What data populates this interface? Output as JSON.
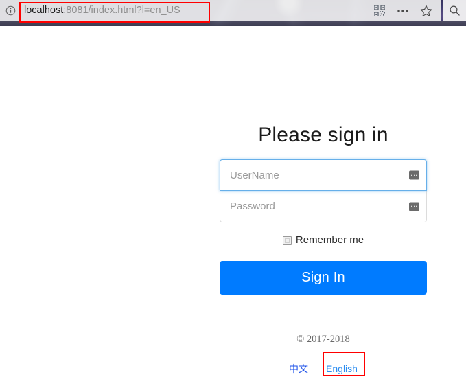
{
  "browser": {
    "site_info_icon": "info-circle-icon",
    "url": {
      "host": "localhost",
      "rest": ":8081/index.html?l=en_US",
      "full": "localhost:8081/index.html?l=en_US"
    },
    "actions": [
      {
        "name": "qr-code-icon",
        "label": "QR code"
      },
      {
        "name": "more-options-icon",
        "label": "More"
      },
      {
        "name": "favorite-star-icon",
        "label": "Add to favorites"
      }
    ],
    "search_button": {
      "name": "search-icon",
      "label": "Search"
    }
  },
  "annotations": {
    "url_highlight": "red-rectangle-around-address-bar",
    "english_highlight": "red-rectangle-around-english-link"
  },
  "page": {
    "title": "Please sign in",
    "username": {
      "placeholder": "UserName",
      "value": "",
      "addon_icon": "broken-image-icon"
    },
    "password": {
      "placeholder": "Password",
      "value": "",
      "addon_icon": "broken-image-icon"
    },
    "remember": {
      "label": "Remember me",
      "checked": false
    },
    "submit_label": "Sign In",
    "copyright": "© 2017-2018",
    "languages": [
      {
        "id": "zh",
        "label": "中文"
      },
      {
        "id": "en",
        "label": "English"
      }
    ]
  },
  "colors": {
    "accent": "#007bff",
    "focus_border": "#66afe9",
    "link": "#1a73e8",
    "annotation": "#ff0000"
  }
}
